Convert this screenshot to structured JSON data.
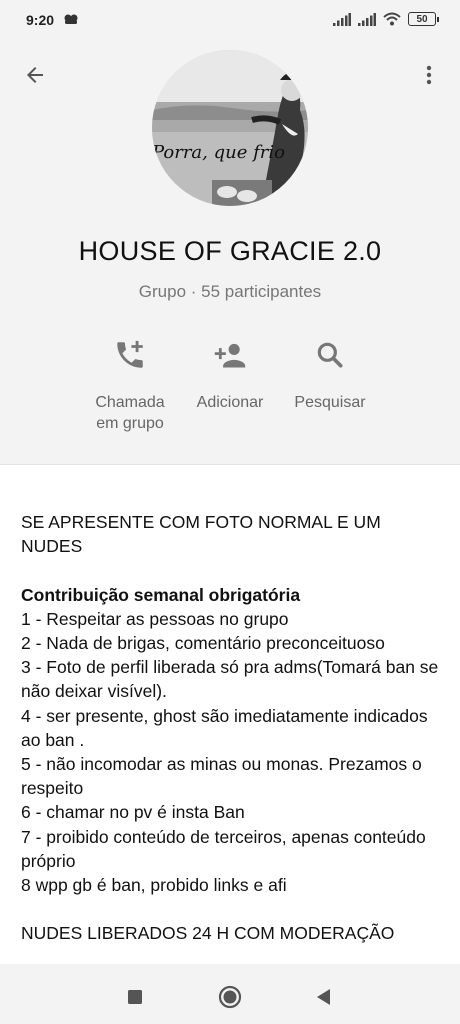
{
  "status_bar": {
    "time": "9:20",
    "battery": "50"
  },
  "header": {
    "back_icon": "arrow-back-icon",
    "menu_icon": "more-vert-icon",
    "avatar_caption": "Porra, que frio",
    "title": "HOUSE OF GRACIE 2.0",
    "subtitle": "Grupo · 55 participantes"
  },
  "actions": [
    {
      "icon": "add-call-icon",
      "line1": "Chamada",
      "line2": "em grupo"
    },
    {
      "icon": "person-add-icon",
      "line1": "Adicionar",
      "line2": ""
    },
    {
      "icon": "search-icon",
      "line1": "Pesquisar",
      "line2": ""
    }
  ],
  "description": {
    "intro": "SE APRESENTE COM FOTO NORMAL E UM NUDES",
    "heading": "Contribuição semanal obrigatória",
    "rules": [
      "1 - Respeitar as pessoas no grupo",
      "2 - Nada de brigas,  comentário preconceituoso",
      "3 - Foto de perfil liberada só pra adms(Tomará ban se não deixar visível).",
      "4 - ser presente, ghost são imediatamente indicados ao ban .",
      "5 - não incomodar as minas ou monas. Prezamos o respeito",
      "6 - chamar no pv é insta Ban",
      "7 - proibido conteúdo de terceiros, apenas conteúdo próprio",
      "8 wpp gb é ban, probido links e afi"
    ],
    "footer": "NUDES LIBERADOS 24 H COM MODERAÇÃO"
  },
  "nav_bar": {
    "icons": [
      "recents-icon",
      "home-icon",
      "back-nav-icon"
    ]
  }
}
